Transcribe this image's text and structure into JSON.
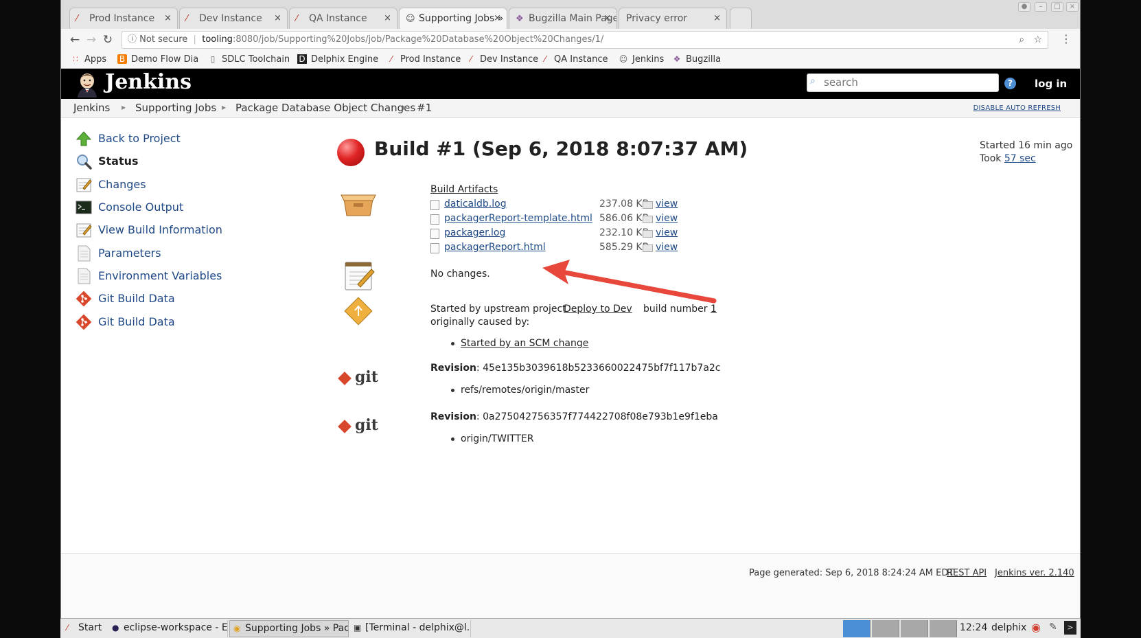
{
  "browser": {
    "tabs": [
      {
        "label": "Prod Instance",
        "icon": "delphix-icon"
      },
      {
        "label": "Dev Instance",
        "icon": "delphix-icon"
      },
      {
        "label": "QA Instance",
        "icon": "delphix-icon"
      },
      {
        "label": "Supporting Jobs »",
        "icon": "jenkins-icon"
      },
      {
        "label": "Bugzilla Main Page",
        "icon": "bugzilla-icon"
      },
      {
        "label": "Privacy error",
        "icon": ""
      }
    ],
    "close_glyph": "×",
    "address": {
      "security": "Not secure",
      "host": "tooling",
      "path": ":8080/job/Supporting%20Jobs/job/Package%20Database%20Object%20Changes/1/"
    },
    "bookmarks": [
      {
        "label": "Apps",
        "icon": "apps-grid-icon"
      },
      {
        "label": "Demo Flow Dia",
        "icon": "blogger-icon"
      },
      {
        "label": "SDLC Toolchain",
        "icon": "page-icon"
      },
      {
        "label": "Delphix Engine",
        "icon": "delphix-d-icon"
      },
      {
        "label": "Prod Instance",
        "icon": "delphix-icon"
      },
      {
        "label": "Dev Instance",
        "icon": "delphix-icon"
      },
      {
        "label": "QA Instance",
        "icon": "delphix-icon"
      },
      {
        "label": "Jenkins",
        "icon": "jenkins-icon"
      },
      {
        "label": "Bugzilla",
        "icon": "bugzilla-icon"
      }
    ]
  },
  "jenkins": {
    "title": "Jenkins",
    "search_placeholder": "search",
    "help": "?",
    "login": "log in",
    "breadcrumbs": [
      "Jenkins",
      "Supporting Jobs",
      "Package Database Object Changes",
      "#1"
    ],
    "auto_refresh": "DISABLE AUTO REFRESH",
    "side_panel": [
      {
        "label": "Back to Project",
        "icon": "up-arrow-icon"
      },
      {
        "label": "Status",
        "icon": "magnifier-icon"
      },
      {
        "label": "Changes",
        "icon": "notepad-icon"
      },
      {
        "label": "Console Output",
        "icon": "terminal-icon"
      },
      {
        "label": "View Build Information",
        "icon": "notepad-icon"
      },
      {
        "label": "Parameters",
        "icon": "document-icon"
      },
      {
        "label": "Environment Variables",
        "icon": "document-icon"
      },
      {
        "label": "Git Build Data",
        "icon": "git-icon"
      },
      {
        "label": "Git Build Data",
        "icon": "git-icon"
      }
    ],
    "build_title": "Build #1 (Sep 6, 2018 8:07:37 AM)",
    "started_ago": "Started 16 min ago",
    "took_prefix": "Took",
    "took_value": "57 sec",
    "artifacts_heading": "Build Artifacts",
    "artifacts": [
      {
        "name": "daticaldb.log",
        "size": "237.08 KB",
        "action": "view"
      },
      {
        "name": "packagerReport-template.html",
        "size": "586.06 KB",
        "action": "view"
      },
      {
        "name": "packager.log",
        "size": "232.10 KB",
        "action": "view"
      },
      {
        "name": "packagerReport.html",
        "size": "585.29 KB",
        "action": "view"
      }
    ],
    "no_changes": "No changes.",
    "cause": {
      "prefix": "Started by upstream project",
      "project": "Deploy to Dev",
      "build_label": "build number",
      "build_number": "1",
      "caused_by": "originally caused by:",
      "scm": "Started by an SCM change"
    },
    "git_label": "git",
    "revisions": [
      {
        "label": "Revision",
        "sha": ": 45e135b3039618b5233660022475bf7f117b7a2c",
        "ref": "refs/remotes/origin/master"
      },
      {
        "label": "Revision",
        "sha": ": 0a275042756357f774422708f08e793b1e9f1eba",
        "ref": "origin/TWITTER"
      }
    ],
    "footer": {
      "generated": "Page generated: Sep 6, 2018 8:24:24 AM EDT",
      "rest_api": "REST API",
      "version": "Jenkins ver. 2.140"
    }
  },
  "annotation_arrow_color": "#e8473b",
  "taskbar": {
    "items": [
      {
        "label": "Start",
        "icon": "delphix-icon"
      },
      {
        "label": "eclipse-workspace - E...",
        "icon": "eclipse-icon"
      },
      {
        "label": "Supporting Jobs » Pac...",
        "icon": "chrome-icon"
      },
      {
        "label": "[Terminal - delphix@l...",
        "icon": "terminal-icon"
      }
    ],
    "clock": "12:24",
    "user": "delphix"
  }
}
